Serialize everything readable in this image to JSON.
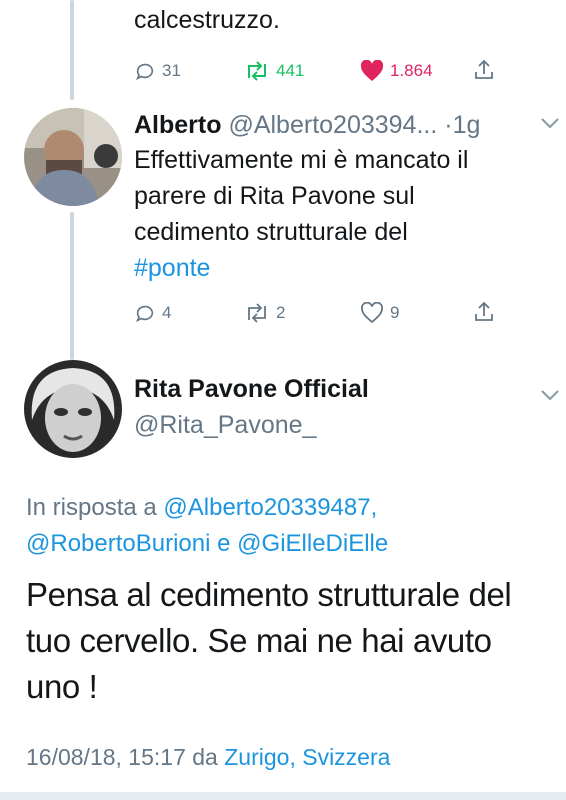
{
  "prev_tweet": {
    "text_tail": "calcestruzzo.",
    "replies": "31",
    "retweets": "441",
    "likes": "1.864"
  },
  "reply_tweet": {
    "name": "Alberto",
    "handle": "@Alberto203394...",
    "separator": "·",
    "time": "1g",
    "text_line1": "Effettivamente mi è mancato il",
    "text_line2": "parere di Rita Pavone sul",
    "text_line3": "cedimento strutturale del",
    "hashtag": "#ponte",
    "replies": "4",
    "retweets": "2",
    "likes": "9"
  },
  "main_tweet": {
    "name": "Rita Pavone Official",
    "handle": "@Rita_Pavone_",
    "in_reply_label": "In risposta a",
    "mention1": "@Alberto20339487,",
    "mention2": "@RobertoBurioni",
    "conj": "e",
    "mention3": "@GiElleDiElle",
    "text_line1": "Pensa al cedimento strutturale del",
    "text_line2": "tuo cervello. Se mai ne hai avuto",
    "text_line3": "uno !",
    "timestamp": "16/08/18, 15:17",
    "via": "da",
    "location": "Zurigo, Svizzera"
  },
  "colors": {
    "like_active": "#e0245e",
    "retweet_active": "#17bf63",
    "link": "#1b95e0",
    "muted": "#657786"
  }
}
